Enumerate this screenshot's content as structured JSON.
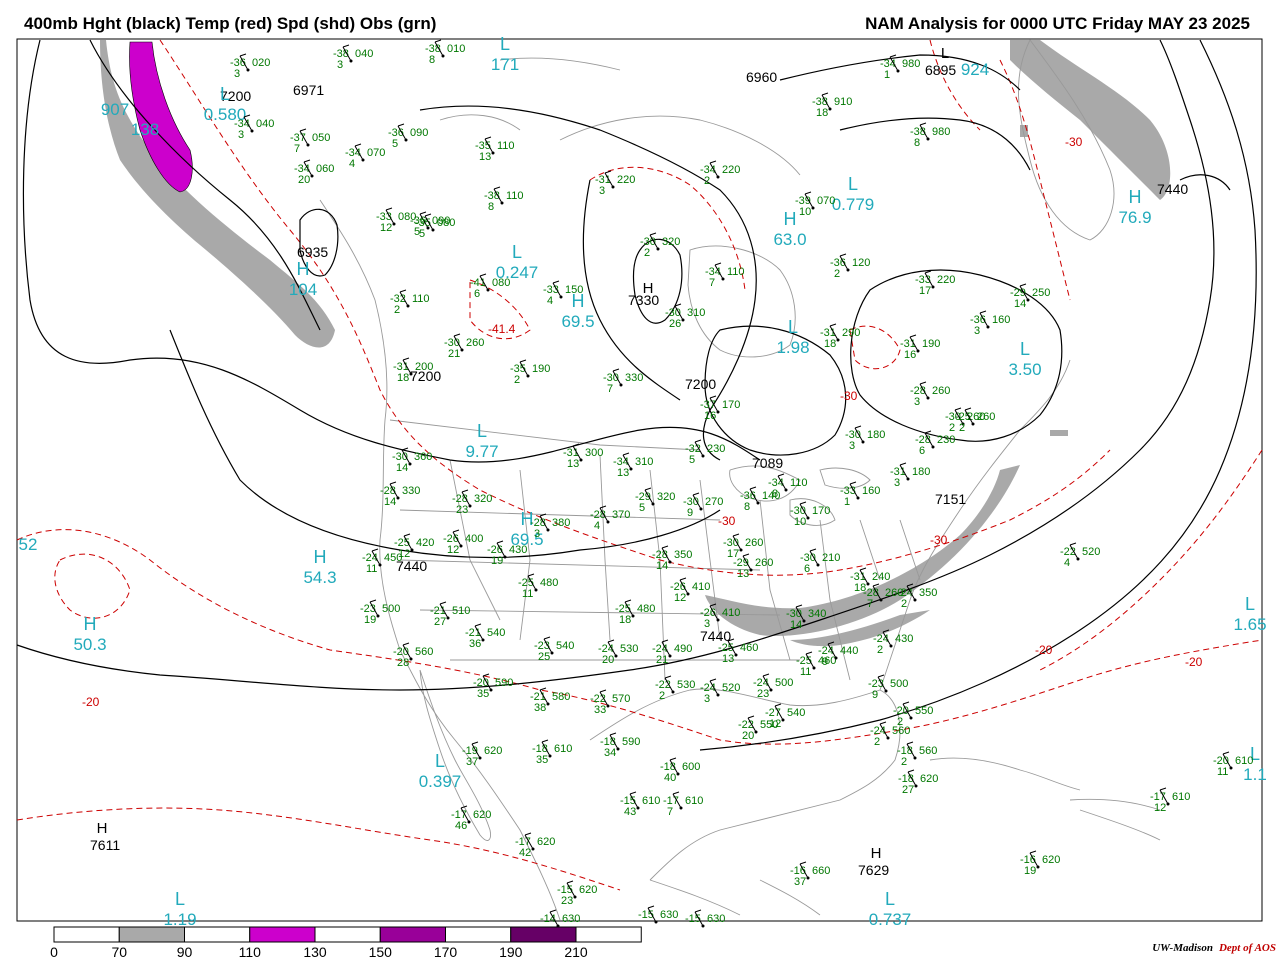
{
  "header": {
    "left_title": "400mb Hght (black) Temp (red) Spd (shd) Obs (grn)",
    "right_title": "NAM Analysis for 0000 UTC Friday  MAY 23 2025"
  },
  "colors": {
    "height_contour": "#000000",
    "temperature_contour": "#cc0000",
    "observations": "#007700",
    "centers_cyan": "#22aabb",
    "geography": "#999999",
    "speed_70_90": "#a9a9a9",
    "speed_110_130": "#cc00cc",
    "speed_150_170": "#990099",
    "speed_190_210": "#660066"
  },
  "colorbar": {
    "labels": [
      "0",
      "70",
      "90",
      "110",
      "130",
      "150",
      "170",
      "190",
      "210"
    ],
    "fills": [
      "#ffffff",
      "#a9a9a9",
      "#ffffff",
      "#cc00cc",
      "#ffffff",
      "#990099",
      "#ffffff",
      "#660066",
      "#ffffff"
    ]
  },
  "credit": {
    "org": "UW-Madison",
    "dept": "Dept of AOS"
  },
  "height_labels": [
    "6971",
    "6935",
    "7200",
    "7330",
    "7200",
    "7089",
    "7440",
    "7440",
    "7151",
    "6960",
    "6895",
    "7440",
    "7611",
    "7629",
    "7200"
  ],
  "centers": [
    {
      "letter": "H",
      "value": "7611"
    },
    {
      "letter": "H",
      "value": "7629"
    },
    {
      "letter": "H",
      "value": "7330"
    },
    {
      "letter": "L",
      "value": "6895"
    }
  ],
  "speed_centers": [
    {
      "letter": "H",
      "value": "104"
    },
    {
      "letter": "L",
      "value": "0.580"
    },
    {
      "letter": "L",
      "value": "0.247"
    },
    {
      "letter": "H",
      "value": "69.5"
    },
    {
      "letter": "H",
      "value": "63.0"
    },
    {
      "letter": "L",
      "value": "0.779"
    },
    {
      "letter": "H",
      "value": "76.9"
    },
    {
      "letter": "L",
      "value": "1.98"
    },
    {
      "letter": "L",
      "value": "3.50"
    },
    {
      "letter": "L",
      "value": "9.77"
    },
    {
      "letter": "H",
      "value": "69.5"
    },
    {
      "letter": "H",
      "value": "54.3"
    },
    {
      "letter": "H",
      "value": "50.3"
    },
    {
      "letter": "L",
      "value": "0.397"
    },
    {
      "letter": "L",
      "value": "1.19"
    },
    {
      "letter": "L",
      "value": "0.737"
    },
    {
      "letter": "L",
      "value": "171"
    },
    {
      "letter": "L",
      "value": "1.65"
    },
    {
      "letter": "L",
      "value": "1.1"
    },
    {
      "letter": "",
      "value": "52"
    },
    {
      "letter": "",
      "value": "907"
    },
    {
      "letter": "",
      "value": "138"
    },
    {
      "letter": "",
      "value": "924"
    }
  ],
  "temp_labels": [
    "-30",
    "-30",
    "-20",
    "-20",
    "-20",
    "-41.4",
    "-30",
    "-30"
  ],
  "stations": [
    {
      "t": "-36",
      "h": "020",
      "d": "3"
    },
    {
      "t": "-38",
      "h": "040",
      "d": "3"
    },
    {
      "t": "-38",
      "h": "010",
      "d": "8"
    },
    {
      "t": "-34",
      "h": "040",
      "d": "3"
    },
    {
      "t": "-37",
      "h": "050",
      "d": "7"
    },
    {
      "t": "-34",
      "h": "070",
      "d": "4"
    },
    {
      "t": "-34",
      "h": "060",
      "d": "20"
    },
    {
      "t": "-36",
      "h": "090",
      "d": "5"
    },
    {
      "t": "-35",
      "h": "110",
      "d": "13"
    },
    {
      "t": "-38",
      "h": "110",
      "d": "8"
    },
    {
      "t": "-31",
      "h": "220",
      "d": "3"
    },
    {
      "t": "-34",
      "h": "220",
      "d": "2"
    },
    {
      "t": "-33",
      "h": "080",
      "d": "12"
    },
    {
      "t": "-36",
      "h": "090",
      "d": "5"
    },
    {
      "t": "-39",
      "h": "070",
      "d": "10"
    },
    {
      "t": "-30",
      "h": "320",
      "d": "2"
    },
    {
      "t": "-36",
      "h": "120",
      "d": "2"
    },
    {
      "t": "-41",
      "h": "080",
      "d": "6"
    },
    {
      "t": "-33",
      "h": "150",
      "d": "4"
    },
    {
      "t": "-32",
      "h": "110",
      "d": "2"
    },
    {
      "t": "-30",
      "h": "310",
      "d": "26"
    },
    {
      "t": "-33",
      "h": "220",
      "d": "17"
    },
    {
      "t": "-36",
      "h": "160",
      "d": "3"
    },
    {
      "t": "-31",
      "h": "190",
      "d": "16"
    },
    {
      "t": "-31",
      "h": "290",
      "d": "18"
    },
    {
      "t": "-30",
      "h": "260",
      "d": "21"
    },
    {
      "t": "-31",
      "h": "200",
      "d": "18"
    },
    {
      "t": "-35",
      "h": "190",
      "d": "2"
    },
    {
      "t": "-30",
      "h": "330",
      "d": "7"
    },
    {
      "t": "-37",
      "h": "170",
      "d": "16"
    },
    {
      "t": "-28",
      "h": "260",
      "d": "3"
    },
    {
      "t": "-30",
      "h": "260",
      "d": "2"
    },
    {
      "t": "-25",
      "h": "260",
      "d": "2"
    },
    {
      "t": "-30",
      "h": "180",
      "d": "3"
    },
    {
      "t": "-28",
      "h": "230",
      "d": "6"
    },
    {
      "t": "-31",
      "h": "300",
      "d": "13"
    },
    {
      "t": "-30",
      "h": "360",
      "d": "14"
    },
    {
      "t": "-32",
      "h": "230",
      "d": "5"
    },
    {
      "t": "-31",
      "h": "180",
      "d": "3"
    },
    {
      "t": "-34",
      "h": "310",
      "d": "13"
    },
    {
      "t": "-34",
      "h": "110",
      "d": "8"
    },
    {
      "t": "-33",
      "h": "160",
      "d": "1"
    },
    {
      "t": "-28",
      "h": "330",
      "d": "14"
    },
    {
      "t": "-28",
      "h": "320",
      "d": "23"
    },
    {
      "t": "-29",
      "h": "320",
      "d": "5"
    },
    {
      "t": "-30",
      "h": "270",
      "d": "9"
    },
    {
      "t": "-30",
      "h": "170",
      "d": "10"
    },
    {
      "t": "-36",
      "h": "140",
      "d": "8"
    },
    {
      "t": "-25",
      "h": "420",
      "d": "12"
    },
    {
      "t": "-26",
      "h": "400",
      "d": "12"
    },
    {
      "t": "-28",
      "h": "380",
      "d": "3"
    },
    {
      "t": "-28",
      "h": "370",
      "d": "4"
    },
    {
      "t": "-26",
      "h": "430",
      "d": "19"
    },
    {
      "t": "-28",
      "h": "350",
      "d": "14"
    },
    {
      "t": "-30",
      "h": "260",
      "d": "17"
    },
    {
      "t": "-30",
      "h": "210",
      "d": "6"
    },
    {
      "t": "-22",
      "h": "520",
      "d": "4"
    },
    {
      "t": "-24",
      "h": "450",
      "d": "11"
    },
    {
      "t": "-25",
      "h": "480",
      "d": "11"
    },
    {
      "t": "-26",
      "h": "410",
      "d": "12"
    },
    {
      "t": "-29",
      "h": "260",
      "d": "13"
    },
    {
      "t": "-31",
      "h": "240",
      "d": "18"
    },
    {
      "t": "-28",
      "h": "260",
      "d": "7"
    },
    {
      "t": "-24",
      "h": "350",
      "d": "2"
    },
    {
      "t": "-23",
      "h": "500",
      "d": "19"
    },
    {
      "t": "-21",
      "h": "510",
      "d": "27"
    },
    {
      "t": "-25",
      "h": "480",
      "d": "18"
    },
    {
      "t": "-26",
      "h": "410",
      "d": "3"
    },
    {
      "t": "-30",
      "h": "340",
      "d": "14"
    },
    {
      "t": "-21",
      "h": "540",
      "d": "36"
    },
    {
      "t": "-23",
      "h": "540",
      "d": "25"
    },
    {
      "t": "-24",
      "h": "530",
      "d": "20"
    },
    {
      "t": "-24",
      "h": "490",
      "d": "21"
    },
    {
      "t": "-25",
      "h": "460",
      "d": "13"
    },
    {
      "t": "-25",
      "h": "460",
      "d": "11"
    },
    {
      "t": "-24",
      "h": "440",
      "d": "9"
    },
    {
      "t": "-24",
      "h": "430",
      "d": "2"
    },
    {
      "t": "-20",
      "h": "560",
      "d": "28"
    },
    {
      "t": "-20",
      "h": "590",
      "d": "35"
    },
    {
      "t": "-21",
      "h": "580",
      "d": "38"
    },
    {
      "t": "-22",
      "h": "570",
      "d": "33"
    },
    {
      "t": "-22",
      "h": "530",
      "d": "2"
    },
    {
      "t": "-24",
      "h": "520",
      "d": "3"
    },
    {
      "t": "-24",
      "h": "500",
      "d": "23"
    },
    {
      "t": "-23",
      "h": "500",
      "d": "9"
    },
    {
      "t": "-20",
      "h": "550",
      "d": "2"
    },
    {
      "t": "-22",
      "h": "550",
      "d": "20"
    },
    {
      "t": "-27",
      "h": "540",
      "d": "12"
    },
    {
      "t": "-24",
      "h": "560",
      "d": "2"
    },
    {
      "t": "-19",
      "h": "620",
      "d": "37"
    },
    {
      "t": "-18",
      "h": "610",
      "d": "35"
    },
    {
      "t": "-18",
      "h": "590",
      "d": "34"
    },
    {
      "t": "-18",
      "h": "600",
      "d": "40"
    },
    {
      "t": "-18",
      "h": "560",
      "d": "2"
    },
    {
      "t": "-18",
      "h": "620",
      "d": "27"
    },
    {
      "t": "-20",
      "h": "610",
      "d": "11"
    },
    {
      "t": "-17",
      "h": "620",
      "d": "46"
    },
    {
      "t": "-15",
      "h": "610",
      "d": "43"
    },
    {
      "t": "-17",
      "h": "610",
      "d": "7"
    },
    {
      "t": "-17",
      "h": "610",
      "d": "12"
    },
    {
      "t": "-17",
      "h": "620",
      "d": "42"
    },
    {
      "t": "-16",
      "h": "660",
      "d": "37"
    },
    {
      "t": "-16",
      "h": "620",
      "d": "19"
    },
    {
      "t": "-15",
      "h": "620",
      "d": "23"
    },
    {
      "t": "-14",
      "h": "630",
      "d": ""
    },
    {
      "t": "-15",
      "h": "630",
      "d": ""
    },
    {
      "t": "-15",
      "h": "630",
      "d": ""
    },
    {
      "t": "-34",
      "h": "980",
      "d": "1"
    },
    {
      "t": "-38",
      "h": "910",
      "d": "18"
    },
    {
      "t": "-38",
      "h": "980",
      "d": "8"
    },
    {
      "t": "-35",
      "h": "080",
      "d": "5"
    },
    {
      "t": "-34",
      "h": "110",
      "d": "7"
    },
    {
      "t": "-29",
      "h": "250",
      "d": "14"
    }
  ]
}
